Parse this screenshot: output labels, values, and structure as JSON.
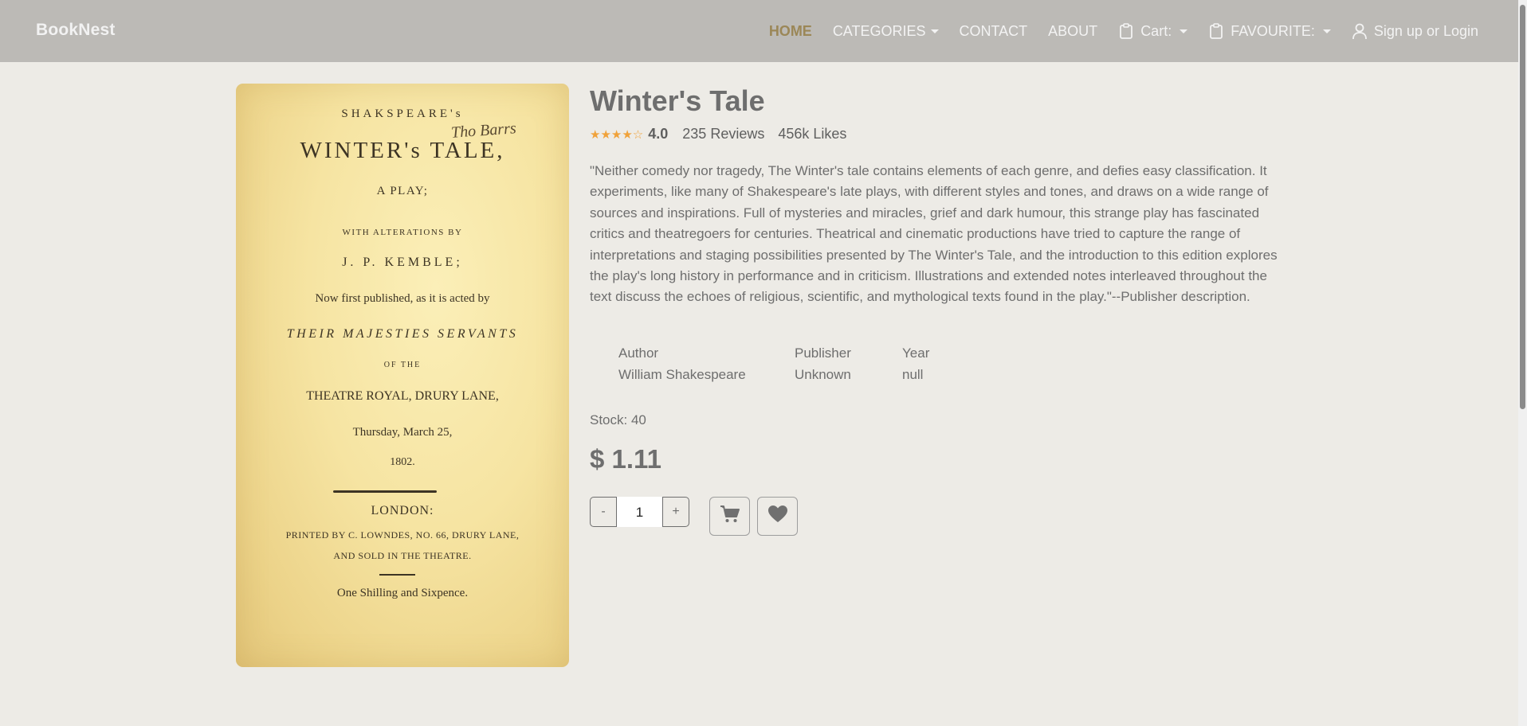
{
  "nav": {
    "brand": "BookNest",
    "home": "HOME",
    "categories": "CATEGORIES",
    "contact": "CONTACT",
    "about": "ABOUT",
    "cart": "Cart:",
    "favourite": "FAVOURITE:",
    "login": "Sign up or Login"
  },
  "cover": {
    "line1": "SHAKSPEARE's",
    "line2": "WINTER's TALE,",
    "line3": "A PLAY;",
    "line4": "WITH ALTERATIONS BY",
    "line5": "J. P. KEMBLE;",
    "line6": "Now first published, as it is acted by",
    "line7": "THEIR MAJESTIES SERVANTS",
    "line8": "OF THE",
    "line9": "THEATRE ROYAL, DRURY LANE,",
    "line10": "Thursday, March 25,",
    "line11": "1802.",
    "line12": "LONDON:",
    "line13": "PRINTED BY C. LOWNDES, NO. 66, DRURY LANE,",
    "line14": "AND SOLD IN THE THEATRE.",
    "line15": "One Shilling and Sixpence.",
    "signature": "Tho Barrs"
  },
  "book": {
    "title": "Winter's Tale",
    "stars": "★★★★☆",
    "rating": "4.0",
    "reviews": "235 Reviews",
    "likes": "456k Likes",
    "description": "\"Neither comedy nor tragedy, The Winter's tale contains elements of each genre, and defies easy classification. It experiments, like many of Shakespeare's late plays, with different styles and tones, and draws on a wide range of sources and inspirations. Full of mysteries and miracles, grief and dark humour, this strange play has fascinated critics and theatregoers for centuries. Theatrical and cinematic productions have tried to capture the range of interpretations and staging possibilities presented by The Winter's Tale, and the introduction to this edition explores the play's long history in performance and in criticism. Illustrations and extended notes interleaved throughout the text discuss the echoes of religious, scientific, and mythological texts found in the play.\"--Publisher description.",
    "author_label": "Author",
    "author": "William Shakespeare",
    "publisher_label": "Publisher",
    "publisher": "Unknown",
    "year_label": "Year",
    "year": "null",
    "stock": "Stock: 40",
    "price": "$ 1.11"
  },
  "qty": {
    "minus": "-",
    "value": "1",
    "plus": "+"
  },
  "icons": {
    "cart": "cart-icon",
    "heart": "heart-icon",
    "clipboard": "clipboard-icon",
    "user": "user-icon"
  },
  "colors": {
    "navbar": "#bcbab6",
    "background": "#edebe6",
    "active": "#9b8757",
    "stars": "#f0a23a"
  }
}
